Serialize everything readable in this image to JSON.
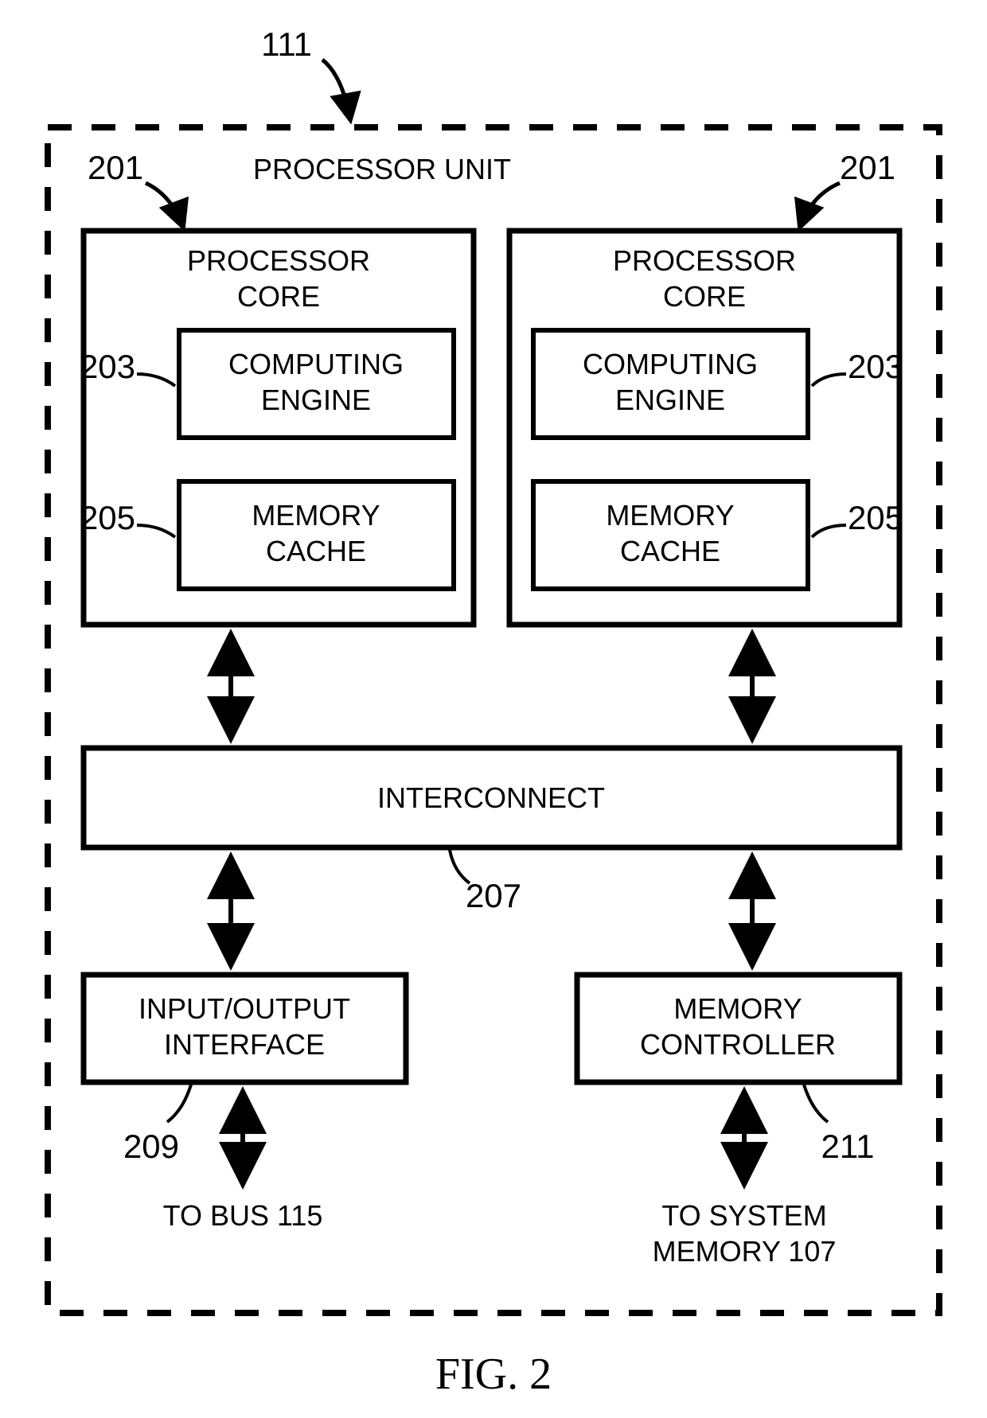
{
  "figure_label": "FIG. 2",
  "refs": {
    "unit": "111",
    "core_left": "201",
    "core_right": "201",
    "engine_left": "203",
    "engine_right": "203",
    "cache_left": "205",
    "cache_right": "205",
    "interconnect": "207",
    "io": "209",
    "mem_ctrl": "211"
  },
  "labels": {
    "unit_title": "PROCESSOR UNIT",
    "core_l1": "PROCESSOR",
    "core_l2": "CORE",
    "engine_l1": "COMPUTING",
    "engine_l2": "ENGINE",
    "cache_l1": "MEMORY",
    "cache_l2": "CACHE",
    "interconnect": "INTERCONNECT",
    "io_l1": "INPUT/OUTPUT",
    "io_l2": "INTERFACE",
    "mem_l1": "MEMORY",
    "mem_l2": "CONTROLLER",
    "to_bus": "TO BUS 115",
    "to_sys_l1": "TO SYSTEM",
    "to_sys_l2": "MEMORY 107"
  }
}
